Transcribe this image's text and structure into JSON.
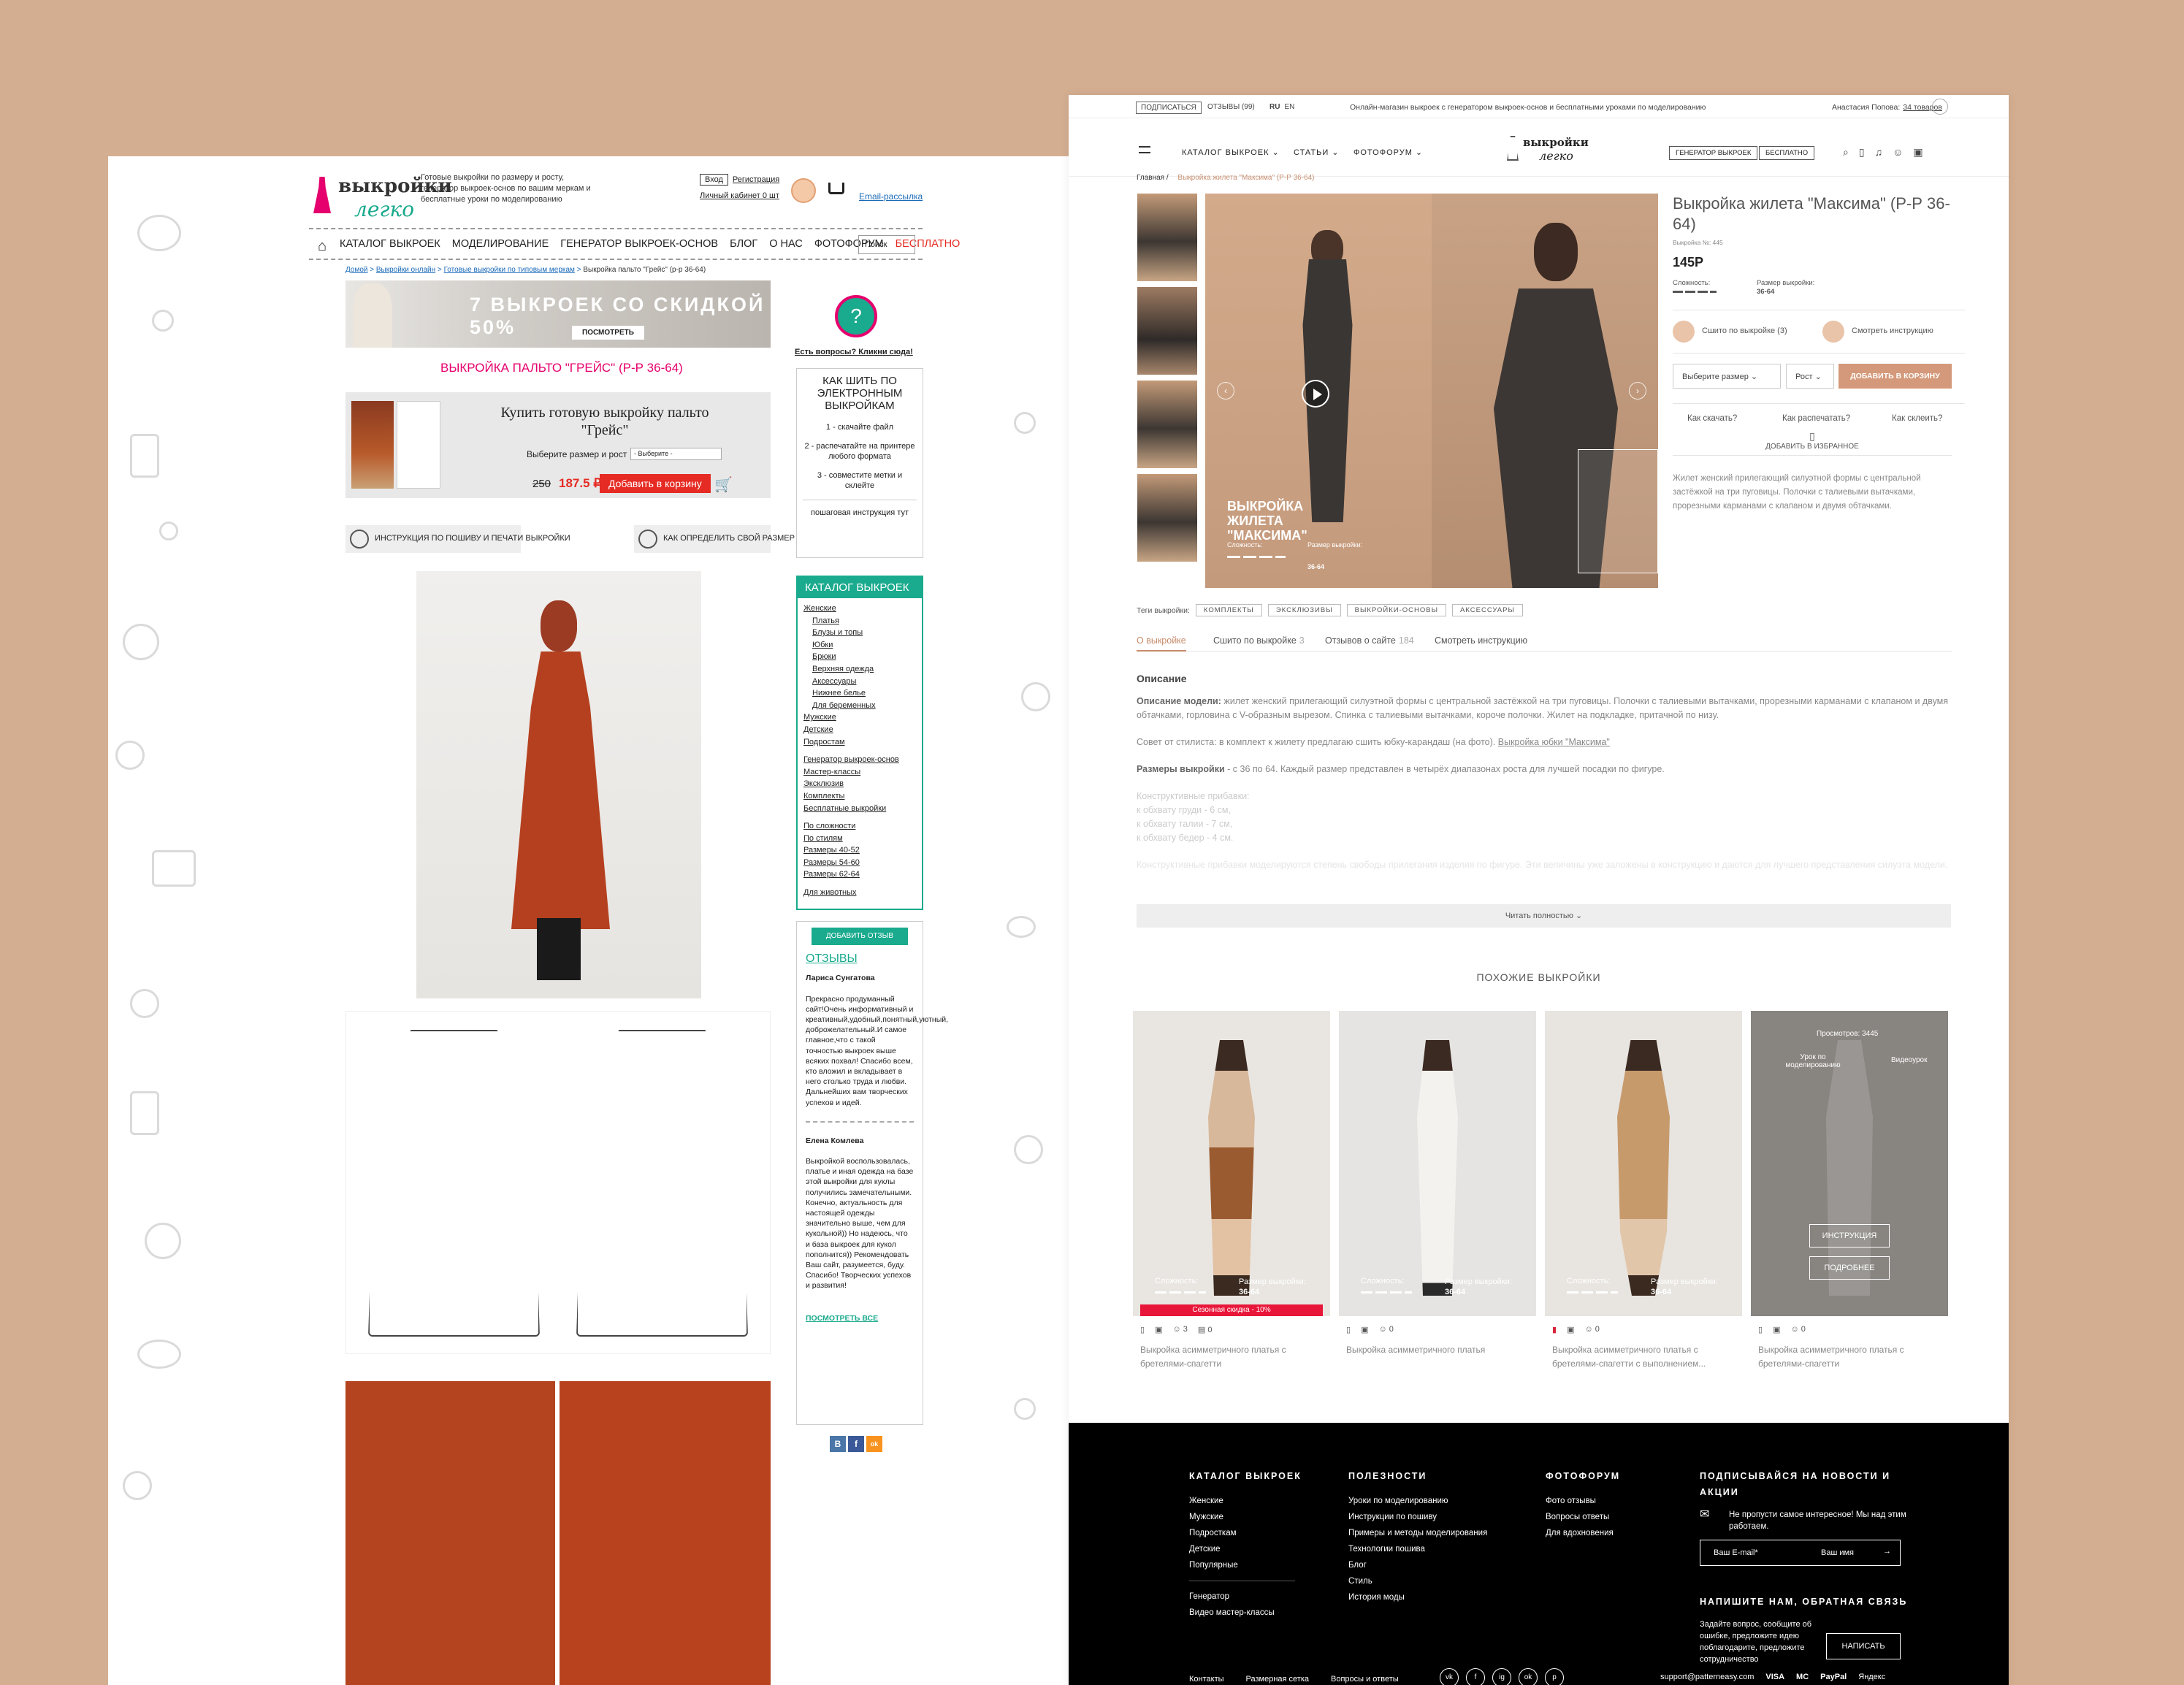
{
  "old_site": {
    "logo": {
      "line1": "выкройки",
      "line2": "легко"
    },
    "tagline": "Готовые выкройки по размеру и росту, генератор выкроек-основ по вашим меркам и бесплатные уроки по моделированию",
    "auth": {
      "login": "Вход",
      "register": "Регистрация",
      "cabinet": "Личный кабинет 0 шт"
    },
    "email_link": "Email-рассылка",
    "nav": [
      "КАТАЛОГ ВЫКРОЕК",
      "МОДЕЛИРОВАНИЕ",
      "ГЕНЕРАТОР ВЫКРОЕК-ОСНОВ",
      "БЛОГ",
      "О НАС",
      "ФОТОФОРУМ",
      "БЕСПЛАТНО"
    ],
    "search_placeholder": "Поиск",
    "breadcrumb": [
      "Домой",
      "Выкройки онлайн",
      "Готовые выкройки по типовым меркам",
      "Выкройка пальто \"Грейс\" (р-р 36-64)"
    ],
    "promo": {
      "text": "7 ВЫКРОЕК СО СКИДКОЙ 50%",
      "button": "ПОСМОТРЕТЬ"
    },
    "product_title": "ВЫКРОЙКА ПАЛЬТО \"ГРЕЙС\" (Р-Р 36-64)",
    "buy": {
      "heading": "Купить готовую выкройку пальто \"Грейс\"",
      "size_label": "Выберите размер и рост",
      "size_select": "- Выберите -",
      "old_price": "250",
      "new_price": "187.5 ₽",
      "add_button": "Добавить в корзину"
    },
    "links": {
      "instruction": "ИНСТРУКЦИЯ ПО ПОШИВУ И ПЕЧАТИ ВЫКРОЙКИ",
      "size": "КАК ОПРЕДЕЛИТЬ СВОЙ РАЗМЕР"
    },
    "question": {
      "mark": "?",
      "text": "Есть вопросы? Кликни сюда!"
    },
    "how_to": {
      "heading": "КАК ШИТЬ ПО ЭЛЕКТРОННЫМ ВЫКРОЙКАМ",
      "steps": [
        "1 - скачайте файл",
        "2 - распечатайте на принтере любого формата",
        "3 - совместите метки и склейте"
      ],
      "footer": "пошаговая инструкция тут"
    },
    "catalog": {
      "heading": "КАТАЛОГ ВЫКРОЕК",
      "women": "Женские",
      "women_sub": [
        "Платья",
        "Блузы и топы",
        "Юбки",
        "Брюки",
        "Верхняя одежда",
        "Аксессуары",
        "Нижнее белье",
        "Для беременных"
      ],
      "groups": [
        "Мужские",
        "Детские",
        "Подростам"
      ],
      "extra": [
        "Генератор выкроек-основ",
        "Мастер-классы",
        "Эксклюзив",
        "Комплекты",
        "Бесплатные выкройки"
      ],
      "filters": [
        "По сложности",
        "По стилям",
        "Размеры 40-52",
        "Размеры 54-60",
        "Размеры 62-64"
      ],
      "pets": "Для животных"
    },
    "reviews": {
      "add_button": "ДОБАВИТЬ ОТЗЫВ",
      "heading": "ОТЗЫВЫ",
      "items": [
        {
          "author": "Лариса Сунгатова",
          "text": "Прекрасно продуманный сайт!Очень информативный и креативный,удобный,понятный,уютный, доброжелательный.И самое главное,что с такой точностью выкроек выше всяких похвал! Спасибо всем, кто вложил и вкладывает в него столько труда и любви. Дальнейших вам творческих успехов и идей."
        },
        {
          "author": "Елена Комлева",
          "text": "Выкройкой воспользовалась, платье и иная одежда на базе этой выкройки для куклы получились замечательными. Конечно, актуальность для настоящей одежды значительно выше, чем для кукольной)) Но надеюсь, что и база выкроек для кукол пополнится)) Рекомендовать Ваш сайт, разумеется, буду. Спасибо! Творческих успехов и развития!"
        }
      ],
      "all_link": "ПОСМОТРЕТЬ ВСЕ"
    },
    "social": [
      "В",
      "f",
      "ok"
    ]
  },
  "new_site": {
    "topbar": {
      "subscribe": "ПОДПИСАТЬСЯ",
      "reviews": "ОТЗЫВЫ (99)",
      "lang_ru": "RU",
      "lang_en": "EN",
      "message": "Онлайн-магазин выкроек с генератором выкроек-основ и бесплатными уроками по моделированию",
      "user": "Анастасия Попова:",
      "cart_count": "34 товаров"
    },
    "nav": {
      "catalog": "КАТАЛОГ ВЫКРОЕК ⌄",
      "articles": "СТАТЬИ ⌄",
      "forum": "ФОТОФОРУМ ⌄",
      "logo_line1": "выкройки",
      "logo_line2": "легко",
      "generator": "ГЕНЕРАТОР ВЫКРОЕК",
      "free": "БЕСПЛАТНО"
    },
    "breadcrumb": {
      "home": "Главная",
      "current": "Выкройка жилета \"Максима\" (Р-Р 36-64)"
    },
    "gallery_overlay": {
      "logo": "выкройки легко",
      "title": "ВЫКРОЙКА ЖИЛЕТА \"МАКСИМА\"",
      "difficulty": "Сложность:",
      "size_label": "Размер выкройки:",
      "size_value": "36-64"
    },
    "product": {
      "title": "Выкройка жилета \"Максима\" (Р-Р 36-64)",
      "article": "Выкройка №: 445",
      "price": "145Р",
      "difficulty_label": "Сложность:",
      "size_label": "Размер выкройки:",
      "size_value": "36-64",
      "sewn": "Сшито по выкройке (3)",
      "instruction": "Смотреть инструкцию",
      "size_select": "Выберите размер ⌄",
      "height_select": "Рост ⌄",
      "cart_button": "ДОБАВИТЬ В КОРЗИНУ",
      "how_download": "Как скачать?",
      "how_print": "Как распечатать?",
      "how_glue": "Как склеить?",
      "favorite": "ДОБАВИТЬ В ИЗБРАННОЕ",
      "description": "Жилет женский прилегающий силуэтной формы с центральной застёжкой на три пуговицы. Полочки с талиевыми вытачками, прорезными карманами с клапаном и двумя обтачками."
    },
    "tags": {
      "label": "Теги выкройки:",
      "items": [
        "КОМПЛЕКТЫ",
        "ЭКСКЛЮЗИВЫ",
        "ВЫКРОЙКИ-ОСНОВЫ",
        "АКСЕССУАРЫ"
      ]
    },
    "tabs": [
      {
        "label": "О выкройке",
        "count": ""
      },
      {
        "label": "Сшито по выкройке",
        "count": "3"
      },
      {
        "label": "Отзывов о сайте",
        "count": "184"
      },
      {
        "label": "Смотреть инструкцию",
        "count": ""
      }
    ],
    "description": {
      "heading": "Описание",
      "model_label": "Описание модели:",
      "model_text": " жилет женский прилегающий силуэтной формы с центральной застёжкой на три пуговицы. Полочки с талиевыми вытачками, прорезными карманами с клапаном и двумя обтачками, горловина с V-образным вырезом. Спинка с талиевыми вытачками, короче полочки. Жилет на подкладке, притачной по низу.",
      "stylist": "Совет от стилиста: в комплект к жилету предлагаю сшить юбку-карандаш (на фото). ",
      "stylist_link": "Выкройка юбки \"Максима\"",
      "sizes_label": "Размеры выкройки",
      "sizes_text": " - с 36 по 64. Каждый размер представлен в четырёх диапазонах роста для лучшей посадки по фигуре.",
      "allowances": [
        "Конструктивные прибавки:",
        "к обхвату груди - 6 см,",
        "к обхвату талии - 7 см,",
        "к обхвату бедер - 4 см."
      ],
      "faded": "Конструктивные прибавки моделируются степень свободы прилегания изделия по фигуре. Эти величины уже заложены в конструкцию и даются для лучшего представления силуэта модели.",
      "read_more": "Читать полностью ⌄"
    },
    "similar": {
      "heading": "ПОХОЖИЕ ВЫКРОЙКИ",
      "cards": [
        {
          "difficulty": "Сложность:",
          "size_label": "Размер выкройки:",
          "size": "36-64",
          "sale": "Сезонная скидка - 10%",
          "likes": "3",
          "comments": "0",
          "name": "Выкройка асимметричного платья с бретелями-спагетти"
        },
        {
          "difficulty": "Сложность:",
          "size_label": "Размер выкройки:",
          "size": "36-64",
          "sale": "",
          "likes": "0",
          "comments": "",
          "name": "Выкройка асимметричного платья"
        },
        {
          "difficulty": "Сложность:",
          "size_label": "Размер выкройки:",
          "size": "36-64",
          "sale": "",
          "likes": "0",
          "comments": "",
          "name": "Выкройка асимметричного платья с бретелями-спагетти с выполнением..."
        },
        {
          "views": "Просмотров: 3445",
          "lesson": "Урок по моделированию",
          "video": "Видеоурок",
          "instruction_button": "ИНСТРУКЦИЯ",
          "more_button": "ПОДРОБНЕЕ",
          "likes": "0",
          "name": "Выкройка асимметричного платья с бретелями-спагетти"
        }
      ]
    },
    "footer": {
      "catalog": {
        "heading": "КАТАЛОГ ВЫКРОЕК",
        "items": [
          "Женские",
          "Мужские",
          "Подросткам",
          "Детские",
          "Популярные"
        ],
        "items2": [
          "Генератор",
          "Видео мастер-классы"
        ]
      },
      "useful": {
        "heading": "ПОЛЕЗНОСТИ",
        "items": [
          "Уроки по моделированию",
          "Инструкции по пошиву",
          "Примеры и методы моделирования",
          "Технологии пошива",
          "Блог",
          "Стиль",
          "История моды"
        ]
      },
      "forum": {
        "heading": "ФОТОФОРУМ",
        "items": [
          "Фото отзывы",
          "Вопросы ответы",
          "Для вдохновения"
        ]
      },
      "subscribe": {
        "heading": "ПОДПИСЫВАЙСЯ НА НОВОСТИ И АКЦИИ",
        "text": "Не пропусти самое интересное! Мы над этим работаем.",
        "email_placeholder": "Ваш E-mail*",
        "name_placeholder": "Ваш имя",
        "arrow": "→"
      },
      "contact": {
        "heading": "НАПИШИТЕ НАМ, ОБРАТНАЯ СВЯЗЬ",
        "text": "Задайте вопрос, сообщите об ошибке, предложите идею поблагодарите, предложите сотрудничество",
        "button": "НАПИСАТЬ"
      },
      "bottom_links": [
        "Контакты",
        "Размерная сетка",
        "Вопросы и ответы"
      ],
      "socials": [
        "vk",
        "f",
        "ig",
        "ok",
        "p"
      ],
      "support_email": "support@patterneasy.com",
      "payments": [
        "VISA",
        "MC",
        "PayPal",
        "Яндекс"
      ]
    }
  }
}
